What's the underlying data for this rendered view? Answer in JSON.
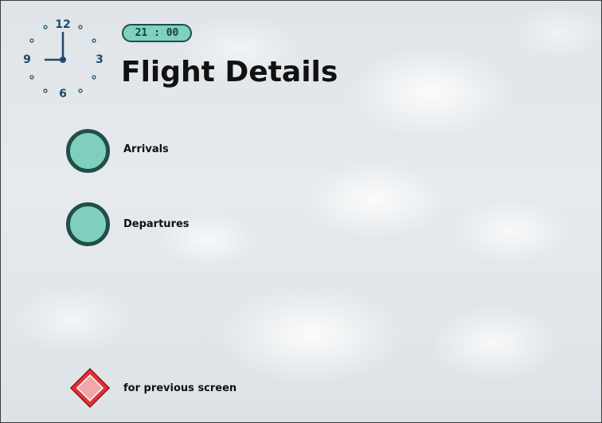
{
  "screen": {
    "title": "Flight Details",
    "time": "21 : 00"
  },
  "clock": {
    "numbers": {
      "n12": "12",
      "n3": "3",
      "n6": "6",
      "n9": "9"
    }
  },
  "menu": {
    "items": [
      {
        "label": "Arrivals"
      },
      {
        "label": "Departures"
      }
    ]
  },
  "footer": {
    "back_label": "for previous screen"
  },
  "colors": {
    "accent_fill": "#80cfbe",
    "accent_border": "#1f4f48",
    "back_button": "#e0333a",
    "clock_ink": "#1d4a6e"
  },
  "icons": {
    "clock": "analog-clock-icon",
    "back": "red-diamond-icon"
  }
}
